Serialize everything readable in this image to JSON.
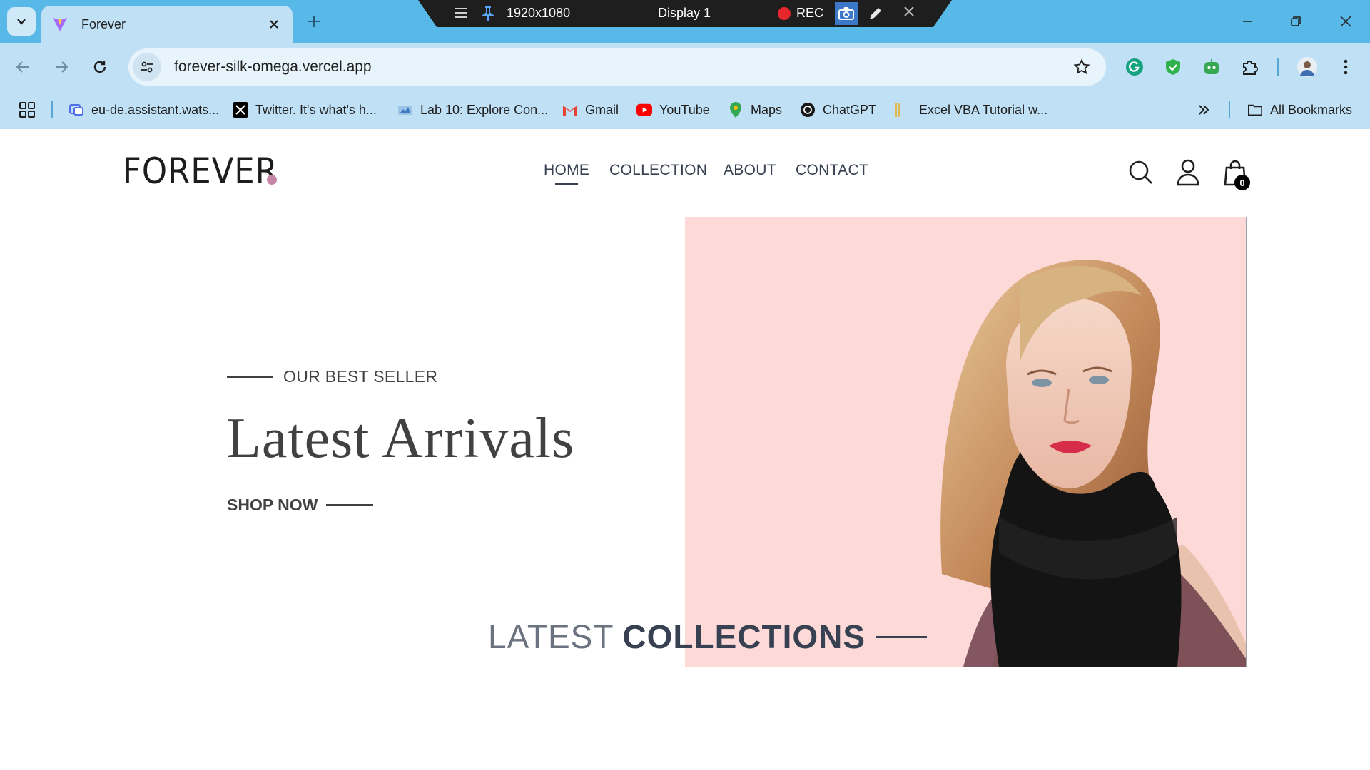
{
  "browser": {
    "tab_title": "Forever",
    "url": "forever-silk-omega.vercel.app",
    "recorder": {
      "resolution": "1920x1080",
      "display": "Display 1",
      "rec_label": "REC"
    },
    "bookmarks": [
      {
        "label": "eu-de.assistant.wats...",
        "icon": "watson-icon"
      },
      {
        "label": "Twitter. It's what's h...",
        "icon": "x-icon"
      },
      {
        "label": "Lab 10: Explore Con...",
        "icon": "lab-icon"
      },
      {
        "label": "Gmail",
        "icon": "gmail-icon"
      },
      {
        "label": "YouTube",
        "icon": "youtube-icon"
      },
      {
        "label": "Maps",
        "icon": "maps-icon"
      },
      {
        "label": "ChatGPT",
        "icon": "chatgpt-icon"
      },
      {
        "label": "Excel VBA Tutorial w...",
        "icon": "bookmark-icon"
      }
    ],
    "all_bookmarks": "All Bookmarks"
  },
  "site": {
    "logo": "FOREVER",
    "accent": "#c586a5",
    "nav": [
      {
        "label": "HOME",
        "active": true
      },
      {
        "label": "COLLECTION",
        "active": false
      },
      {
        "label": "ABOUT",
        "active": false
      },
      {
        "label": "CONTACT",
        "active": false
      }
    ],
    "cart_count": "0",
    "hero": {
      "eyebrow": "OUR BEST SELLER",
      "title": "Latest Arrivals",
      "cta": "SHOP NOW",
      "bg": "#fdd9d8"
    },
    "section": {
      "title_light": "LATEST",
      "title_bold": "COLLECTIONS"
    }
  }
}
